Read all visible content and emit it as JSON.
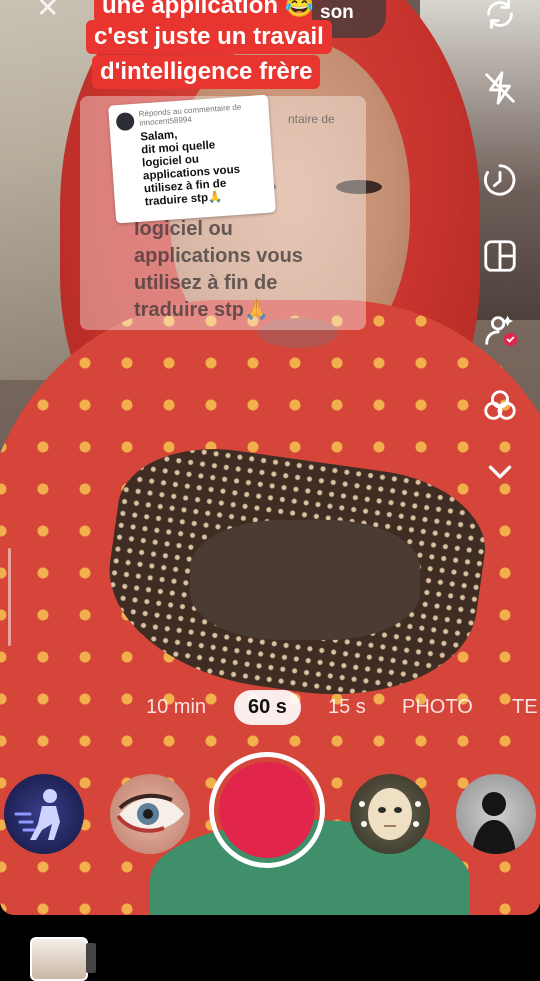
{
  "captions": {
    "line1": "une application 😂",
    "line2": "c'est juste un travail",
    "line3": "d'intelligence frère",
    "sound_label": "son"
  },
  "reply_ghost": {
    "header_fragment": "ntaire de",
    "text": "logiciel ou\napplications vous\nutilisez à fin de\ntraduire stp🙏"
  },
  "reply_card": {
    "header": "Réponds au commentaire de\ninnocent58994",
    "body": "Salam,\ndit moi quelle\nlogiciel ou\napplications vous\nutilisez à fin de\ntraduire stp🙏"
  },
  "side_icons": [
    "flip-camera-icon",
    "flash-off-icon",
    "timer-icon",
    "layout-icon",
    "beauty-icon",
    "filters-icon",
    "chevron-down-icon"
  ],
  "duration_tabs": [
    {
      "label": "10 min",
      "active": false
    },
    {
      "label": "60 s",
      "active": true
    },
    {
      "label": "15 s",
      "active": false
    },
    {
      "label": "PHOTO",
      "active": false
    },
    {
      "label": "TE",
      "active": false
    }
  ],
  "colors": {
    "caption_bg": "#e8352f",
    "record": "#e2254a",
    "badge": "#e2254a"
  }
}
